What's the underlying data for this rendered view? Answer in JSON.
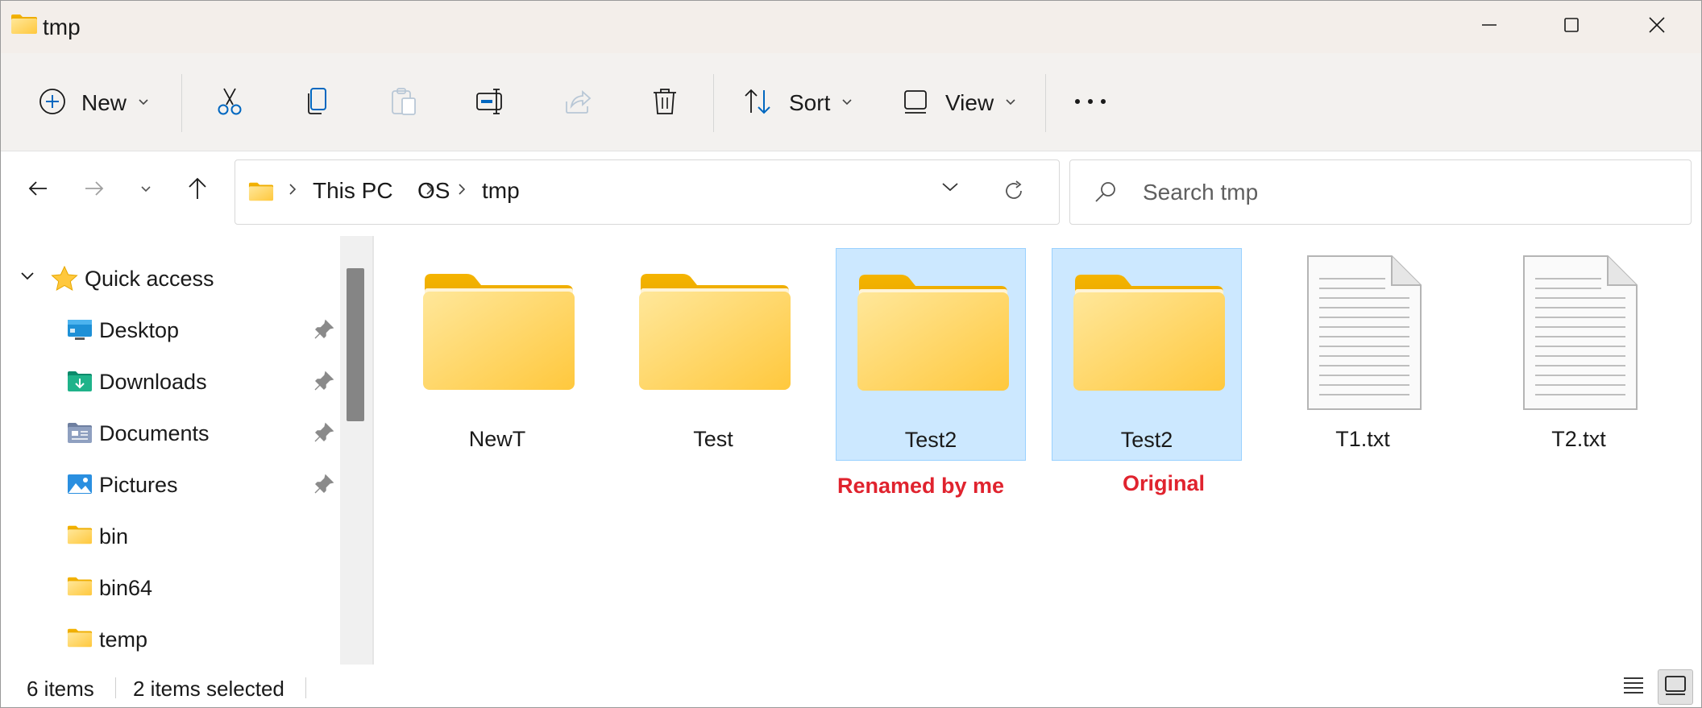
{
  "window": {
    "title": "tmp",
    "icon": "folder-icon",
    "controls": [
      "minimize-icon",
      "maximize-icon",
      "close-icon"
    ]
  },
  "toolbar": {
    "new_label": "New",
    "sort_label": "Sort",
    "view_label": "View",
    "icons": [
      "cut-icon",
      "copy-icon",
      "paste-icon",
      "rename-icon",
      "share-icon",
      "delete-icon",
      "more-icon"
    ]
  },
  "address": {
    "crumbs": [
      "This PC",
      "OS",
      "tmp"
    ]
  },
  "search": {
    "placeholder": "Search tmp"
  },
  "sidebar": {
    "section_label": "Quick access",
    "items": [
      {
        "label": "Desktop",
        "icon": "desktop-icon",
        "pinned": true
      },
      {
        "label": "Downloads",
        "icon": "downloads-icon",
        "pinned": true
      },
      {
        "label": "Documents",
        "icon": "documents-icon",
        "pinned": true
      },
      {
        "label": "Pictures",
        "icon": "pictures-icon",
        "pinned": true
      },
      {
        "label": "bin",
        "icon": "folder-icon",
        "pinned": false
      },
      {
        "label": "bin64",
        "icon": "folder-icon",
        "pinned": false
      },
      {
        "label": "temp",
        "icon": "folder-icon",
        "pinned": false
      }
    ]
  },
  "files": [
    {
      "name": "NewT",
      "type": "folder",
      "selected": false
    },
    {
      "name": "Test",
      "type": "folder",
      "selected": false
    },
    {
      "name": "Test2",
      "type": "folder",
      "selected": true
    },
    {
      "name": "Test2",
      "type": "folder",
      "selected": true
    },
    {
      "name": "T1.txt",
      "type": "text",
      "selected": false
    },
    {
      "name": "T2.txt",
      "type": "text",
      "selected": false
    }
  ],
  "annotations": {
    "renamed": "Renamed by me",
    "original": "Original"
  },
  "status": {
    "count": "6 items",
    "selected": "2 items selected"
  },
  "colors": {
    "selection_fill": "#cce8ff",
    "selection_border": "#99d1ff",
    "annotation_red": "#e0232e",
    "folder_yellow": "#ffc83d",
    "accent_blue": "#0067c0"
  }
}
